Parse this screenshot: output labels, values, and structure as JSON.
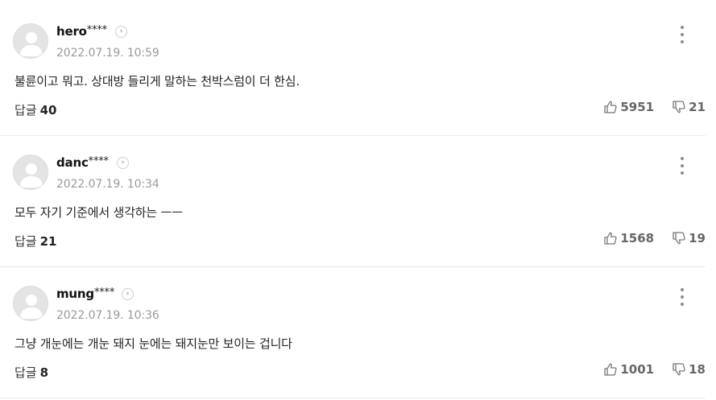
{
  "comments": [
    {
      "nickname": "hero",
      "nickname_mask": "****",
      "date": "2022.07.19. 10:59",
      "text": "불륜이고 뭐고. 상대방 들리게 말하는 천박스럼이 더 한심.",
      "reply_label": "답글",
      "reply_count": "40",
      "likes": "5951",
      "dislikes": "21"
    },
    {
      "nickname": "danc",
      "nickname_mask": "****",
      "date": "2022.07.19. 10:34",
      "text": "모두 자기 기준에서 생각하는 ㅡㅡ",
      "reply_label": "답글",
      "reply_count": "21",
      "likes": "1568",
      "dislikes": "19"
    },
    {
      "nickname": "mung",
      "nickname_mask": "****",
      "date": "2022.07.19. 10:36",
      "text": "그냥 개눈에는 개눈 돼지 눈에는 돼지눈만 보이는 겁니다",
      "reply_label": "답글",
      "reply_count": "8",
      "likes": "1001",
      "dislikes": "18"
    }
  ],
  "icons": {
    "avatar": "default-avatar-icon",
    "profile": "chevron-right-circle-icon",
    "more": "more-vertical-icon",
    "like": "thumbs-up-icon",
    "dislike": "thumbs-down-icon"
  }
}
